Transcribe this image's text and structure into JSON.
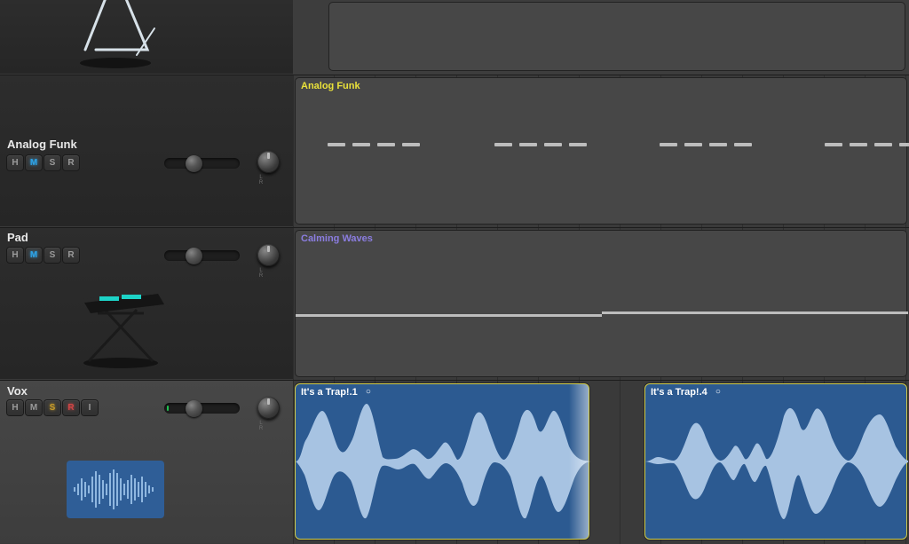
{
  "tracks": [
    {
      "id": "triangle",
      "name": "",
      "buttons": [],
      "icon": "triangle-percussion"
    },
    {
      "id": "analog_funk",
      "name": "Analog Funk",
      "buttons": [
        "H",
        "M",
        "S",
        "R"
      ],
      "active_buttons": {
        "M": "blue"
      },
      "pan_label": "L R",
      "icon": null,
      "region": {
        "name": "Analog Funk",
        "color": "yellow"
      }
    },
    {
      "id": "pad",
      "name": "Pad",
      "buttons": [
        "H",
        "M",
        "S",
        "R"
      ],
      "active_buttons": {
        "M": "blue"
      },
      "pan_label": "L R",
      "icon": "keyboard-on-stand",
      "region": {
        "name": "Calming Waves",
        "color": "purple"
      }
    },
    {
      "id": "vox",
      "name": "Vox",
      "buttons": [
        "H",
        "M",
        "S",
        "R",
        "I"
      ],
      "active_buttons": {
        "S": "yellow",
        "R": "red"
      },
      "pan_label": "L R",
      "icon": "audio-waveform-thumbnail",
      "regions": [
        {
          "name": "It's a Trap!.1",
          "has_loop_dot": true
        },
        {
          "name": "It's a Trap!.4",
          "has_loop_dot": true
        }
      ]
    }
  ],
  "button_labels": {
    "H": "H",
    "M": "M",
    "S": "S",
    "R": "R",
    "I": "I"
  },
  "loop_dot": "○",
  "colors": {
    "blue_active": "#2ea4e8",
    "yellow_active": "#c49a2a",
    "red_active": "#d04646",
    "region_audio": "#2c5a91",
    "region_audio_border": "#d2cd4a",
    "name_yellow": "#eae23a",
    "name_purple": "#8b7de0"
  }
}
